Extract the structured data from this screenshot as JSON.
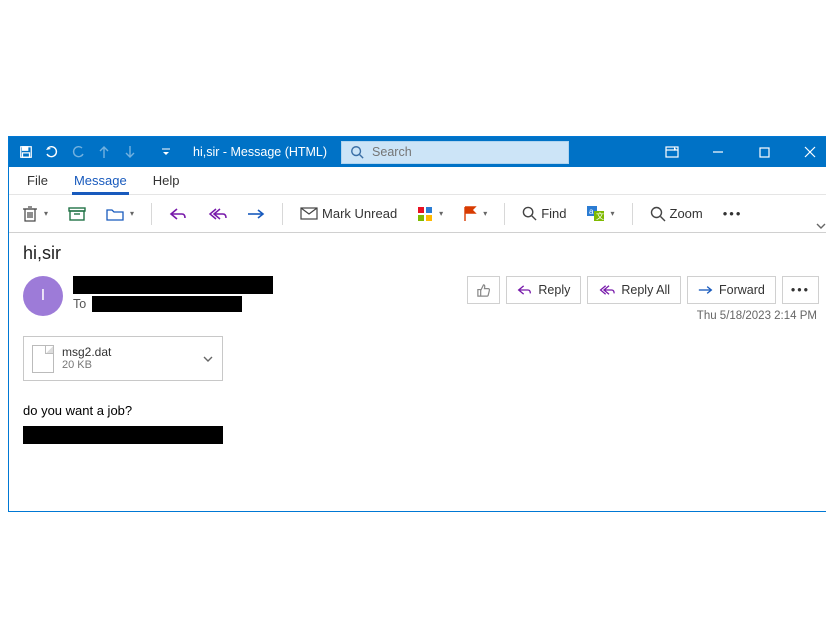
{
  "titlebar": {
    "title": "hi,sir  -  Message (HTML)",
    "search_placeholder": "Search"
  },
  "menubar": {
    "file": "File",
    "message": "Message",
    "help": "Help"
  },
  "ribbon": {
    "mark_unread": "Mark Unread",
    "find": "Find",
    "zoom": "Zoom"
  },
  "mail": {
    "subject": "hi,sir",
    "avatar_initial": "I",
    "to_label": "To",
    "timestamp": "Thu 5/18/2023 2:14 PM",
    "body": "do you want a job?"
  },
  "actions": {
    "reply": "Reply",
    "reply_all": "Reply All",
    "forward": "Forward"
  },
  "attachment": {
    "name": "msg2.dat",
    "size": "20 KB"
  }
}
